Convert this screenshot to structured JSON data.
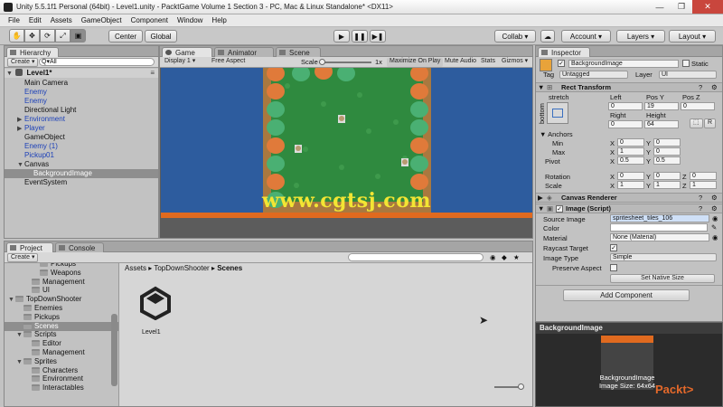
{
  "window_title": "Unity 5.5.1f1 Personal (64bit) - Level1.unity - PacktGame Volume 1 Section 3 - PC, Mac & Linux Standalone* <DX11>",
  "menu": [
    "File",
    "Edit",
    "Assets",
    "GameObject",
    "Component",
    "Window",
    "Help"
  ],
  "toolbar": {
    "center": "Center",
    "global": "Global",
    "collab": "Collab ▾",
    "account": "Account ▾",
    "layers": "Layers ▾",
    "layout": "Layout ▾"
  },
  "hierarchy": {
    "tab": "Hierarchy",
    "create": "Create ▾",
    "search": "Q▾All",
    "scene": "Level1*",
    "items": [
      {
        "label": "Main Camera",
        "indent": 1,
        "blue": false,
        "arrow": ""
      },
      {
        "label": "Enemy",
        "indent": 1,
        "blue": true,
        "arrow": ""
      },
      {
        "label": "Enemy",
        "indent": 1,
        "blue": true,
        "arrow": ""
      },
      {
        "label": "Directional Light",
        "indent": 1,
        "blue": false,
        "arrow": ""
      },
      {
        "label": "Environment",
        "indent": 1,
        "blue": true,
        "arrow": "▶"
      },
      {
        "label": "Player",
        "indent": 1,
        "blue": true,
        "arrow": "▶"
      },
      {
        "label": "GameObject",
        "indent": 1,
        "blue": false,
        "arrow": ""
      },
      {
        "label": "Enemy (1)",
        "indent": 1,
        "blue": true,
        "arrow": ""
      },
      {
        "label": "Pickup01",
        "indent": 1,
        "blue": true,
        "arrow": ""
      },
      {
        "label": "Canvas",
        "indent": 1,
        "blue": false,
        "arrow": "▼"
      },
      {
        "label": "BackgroundImage",
        "indent": 2,
        "blue": false,
        "arrow": "",
        "selected": true
      },
      {
        "label": "EventSystem",
        "indent": 1,
        "blue": false,
        "arrow": ""
      }
    ]
  },
  "game": {
    "tabs": [
      "Game",
      "Animator",
      "Scene"
    ],
    "display": "Display 1 ▾",
    "aspect": "Free Aspect",
    "scale_label": "Scale",
    "scale_value": "1x",
    "buttons": [
      "Maximize On Play",
      "Mute Audio",
      "Stats",
      "Gizmos ▾"
    ],
    "watermark": "www.cgtsj.com"
  },
  "project": {
    "tabs": [
      "Project",
      "Console"
    ],
    "create": "Create ▾",
    "tree": [
      {
        "label": "Pickups",
        "indent": 3,
        "arrow": ""
      },
      {
        "label": "Weapons",
        "indent": 3,
        "arrow": ""
      },
      {
        "label": "Management",
        "indent": 2,
        "arrow": ""
      },
      {
        "label": "UI",
        "indent": 2,
        "arrow": ""
      },
      {
        "label": "TopDownShooter",
        "indent": 0,
        "arrow": "▼"
      },
      {
        "label": "Enemies",
        "indent": 1,
        "arrow": ""
      },
      {
        "label": "Pickups",
        "indent": 1,
        "arrow": ""
      },
      {
        "label": "Scenes",
        "indent": 1,
        "arrow": "",
        "selected": true
      },
      {
        "label": "Scripts",
        "indent": 1,
        "arrow": "▼"
      },
      {
        "label": "Editor",
        "indent": 2,
        "arrow": ""
      },
      {
        "label": "Management",
        "indent": 2,
        "arrow": ""
      },
      {
        "label": "Sprites",
        "indent": 1,
        "arrow": "▼"
      },
      {
        "label": "Characters",
        "indent": 2,
        "arrow": ""
      },
      {
        "label": "Environment",
        "indent": 2,
        "arrow": ""
      },
      {
        "label": "Interactables",
        "indent": 2,
        "arrow": ""
      }
    ],
    "breadcrumb": [
      "Assets",
      "TopDownShooter",
      "Scenes"
    ],
    "asset_name": "Level1"
  },
  "inspector": {
    "tab": "Inspector",
    "object_name": "BackgroundImage",
    "static_label": "Static",
    "tag_label": "Tag",
    "tag_value": "Untagged",
    "layer_label": "Layer",
    "layer_value": "UI",
    "rect": {
      "title": "Rect Transform",
      "stretch": "stretch",
      "bottom": "bottom",
      "left_label": "Left",
      "left_val": "0",
      "posy_label": "Pos Y",
      "posy_val": "19",
      "posz_label": "Pos Z",
      "posz_val": "0",
      "right_label": "Right",
      "right_val": "0",
      "height_label": "Height",
      "height_val": "64",
      "r_btn": "R",
      "anchors": "Anchors",
      "min": "Min",
      "max": "Max",
      "pivot": "Pivot",
      "min_x": "0",
      "min_y": "0",
      "max_x": "1",
      "max_y": "0",
      "pivot_x": "0.5",
      "pivot_y": "0.5",
      "rotation": "Rotation",
      "rot_x": "0",
      "rot_y": "0",
      "rot_z": "0",
      "scale": "Scale",
      "scale_x": "1",
      "scale_y": "1",
      "scale_z": "1",
      "x": "X",
      "y": "Y",
      "z": "Z"
    },
    "canvas_renderer": "Canvas Renderer",
    "image": {
      "title": "Image (Script)",
      "source_label": "Source Image",
      "source_val": "spritesheet_tiles_106",
      "color_label": "Color",
      "material_label": "Material",
      "material_val": "None (Material)",
      "raycast_label": "Raycast Target",
      "type_label": "Image Type",
      "type_val": "Simple",
      "preserve_label": "Preserve Aspect",
      "native_btn": "Set Native Size"
    },
    "add_component": "Add Component",
    "preview_title": "BackgroundImage",
    "preview_caption1": "BackgroundImage",
    "preview_caption2": "Image Size: 64x64",
    "packt": "Packt>"
  }
}
